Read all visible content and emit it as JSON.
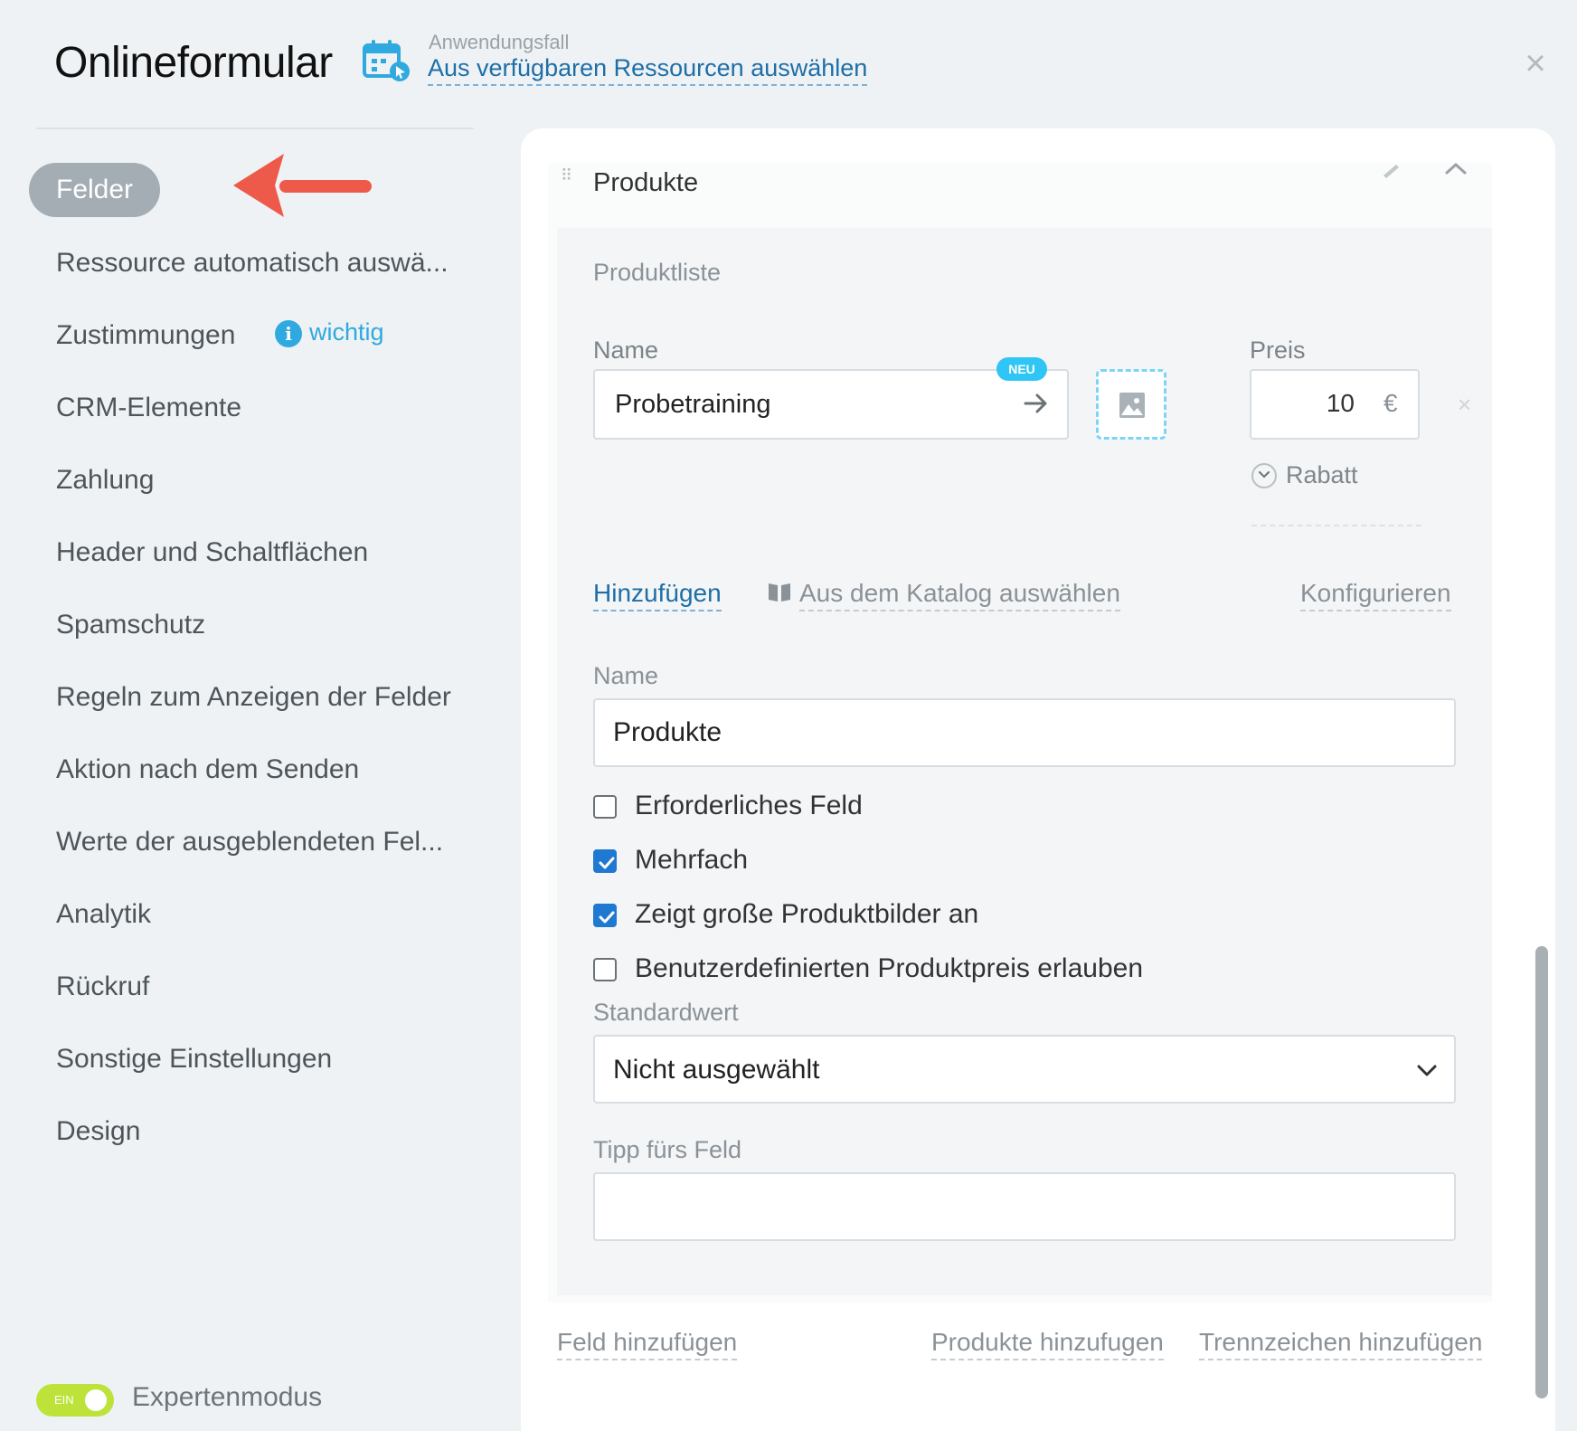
{
  "header": {
    "title": "Onlineformular",
    "usecase_caption": "Anwendungsfall",
    "usecase_link": "Aus verfügbaren Ressourcen auswählen",
    "close_symbol": "×"
  },
  "sidebar": {
    "items": [
      {
        "label": "Felder",
        "active": true
      },
      {
        "label": "Ressource automatisch auswä..."
      },
      {
        "label": "Zustimmungen"
      },
      {
        "label": "CRM-Elemente"
      },
      {
        "label": "Zahlung"
      },
      {
        "label": "Header und Schaltflächen"
      },
      {
        "label": "Spamschutz"
      },
      {
        "label": "Regeln zum Anzeigen der Felder"
      },
      {
        "label": "Aktion nach dem Senden"
      },
      {
        "label": "Werte der ausgeblendeten Fel..."
      },
      {
        "label": "Analytik"
      },
      {
        "label": "Rückruf"
      },
      {
        "label": "Sonstige Einstellungen"
      },
      {
        "label": "Design"
      }
    ],
    "important_badge": "i",
    "important_label": "wichtig",
    "expert_toggle_text": "EIN",
    "expert_mode_label": "Expertenmodus",
    "expert_mode_on": true
  },
  "field_card": {
    "drag_handle": "⠿",
    "title": "Produkte",
    "product_list_label": "Produktliste",
    "name_label": "Name",
    "product_name": "Probetraining",
    "neu_badge": "NEU",
    "price_label": "Preis",
    "price_value": "10",
    "price_currency": "€",
    "price_remove": "×",
    "discount_label": "Rabatt",
    "actions": {
      "add": "Hinzufügen",
      "catalog": "Aus dem Katalog auswählen",
      "configure": "Konfigurieren"
    },
    "field_name_label": "Name",
    "field_name_value": "Produkte",
    "checkboxes": [
      {
        "label": "Erforderliches Feld",
        "checked": false
      },
      {
        "label": "Mehrfach",
        "checked": true
      },
      {
        "label": "Zeigt große Produktbilder an",
        "checked": true
      },
      {
        "label": "Benutzerdefinierten Produktpreis erlauben",
        "checked": false
      }
    ],
    "default_value_label": "Standardwert",
    "default_value_selected": "Nicht ausgewählt",
    "hint_label": "Tipp fürs Feld",
    "hint_value": ""
  },
  "footer_links": {
    "add_field": "Feld hinzufügen",
    "add_products": "Produkte hinzufugen",
    "add_separator": "Trennzeichen hinzufügen"
  },
  "colors": {
    "accent_link": "#1e6ea8",
    "info": "#2fa9e0",
    "toggle_on": "#bde33a",
    "checkbox_checked": "#1f78d1",
    "annotation_arrow": "#ee5a4a"
  },
  "icons": [
    "calendar-cursor-icon",
    "close-icon",
    "arrow-annotation",
    "info-icon",
    "drag-handle-icon",
    "edit-icon",
    "chevron-up-icon",
    "arrow-right-icon",
    "image-icon",
    "chevron-down-icon",
    "book-icon",
    "checkmark-icon"
  ]
}
